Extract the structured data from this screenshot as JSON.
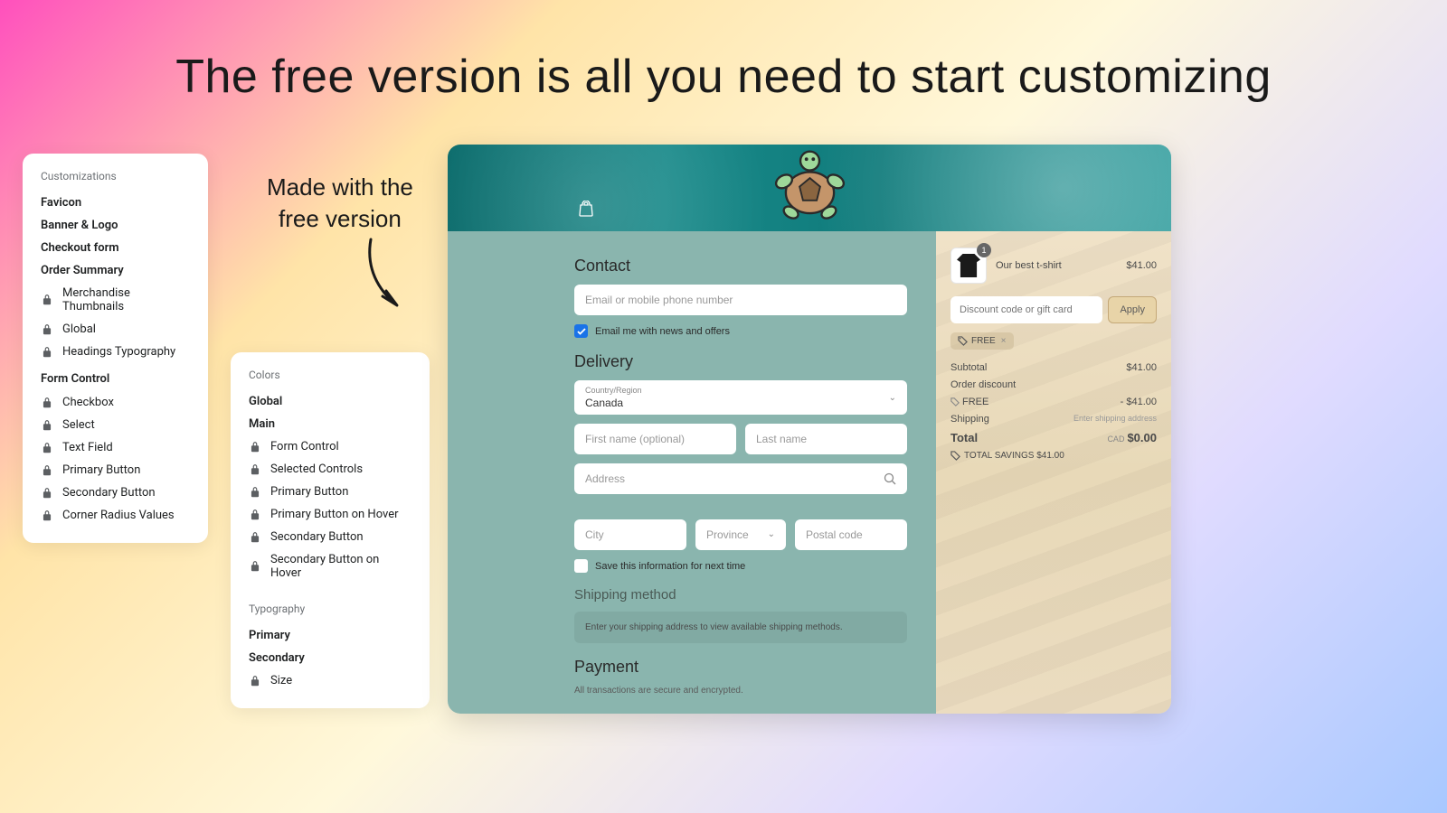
{
  "title": "The free version is all you need to start customizing",
  "annotation": "Made with the\nfree version",
  "panel_left": {
    "header": "Customizations",
    "top_items": [
      "Favicon",
      "Banner & Logo",
      "Checkout form",
      "Order Summary"
    ],
    "order_sub": [
      "Merchandise Thumbnails",
      "Global",
      "Headings Typography"
    ],
    "form_header": "Form Control",
    "form_sub": [
      "Checkbox",
      "Select",
      "Text Field",
      "Primary Button",
      "Secondary Button",
      "Corner Radius Values"
    ]
  },
  "panel_mid": {
    "colors_header": "Colors",
    "colors_top": [
      "Global",
      "Main"
    ],
    "colors_sub": [
      "Form Control",
      "Selected Controls",
      "Primary Button",
      "Primary Button on Hover",
      "Secondary Button",
      "Secondary Button on Hover"
    ],
    "typo_header": "Typography",
    "typo_top": [
      "Primary",
      "Secondary"
    ],
    "typo_sub": [
      "Size"
    ]
  },
  "checkout": {
    "contact": {
      "title": "Contact",
      "placeholder": "Email or mobile phone number",
      "newsletter": "Email me with news and offers"
    },
    "delivery": {
      "title": "Delivery",
      "country_label": "Country/Region",
      "country_value": "Canada",
      "first_name": "First name (optional)",
      "last_name": "Last name",
      "address": "Address",
      "city": "City",
      "province": "Province",
      "postal": "Postal code",
      "save_info": "Save this information for next time"
    },
    "shipping": {
      "title": "Shipping method",
      "note": "Enter your shipping address to view available shipping methods."
    },
    "payment": {
      "title": "Payment",
      "note": "All transactions are secure and encrypted."
    },
    "summary": {
      "product_name": "Our best t-shirt",
      "product_price": "$41.00",
      "qty": "1",
      "discount_placeholder": "Discount code or gift card",
      "apply": "Apply",
      "tag_label": "FREE",
      "subtotal_label": "Subtotal",
      "subtotal_val": "$41.00",
      "discount_label": "Order discount",
      "free_label": "FREE",
      "free_val": "- $41.00",
      "shipping_label": "Shipping",
      "shipping_val": "Enter shipping address",
      "total_label": "Total",
      "total_cur": "CAD",
      "total_val": "$0.00",
      "savings": "TOTAL SAVINGS  $41.00"
    }
  }
}
